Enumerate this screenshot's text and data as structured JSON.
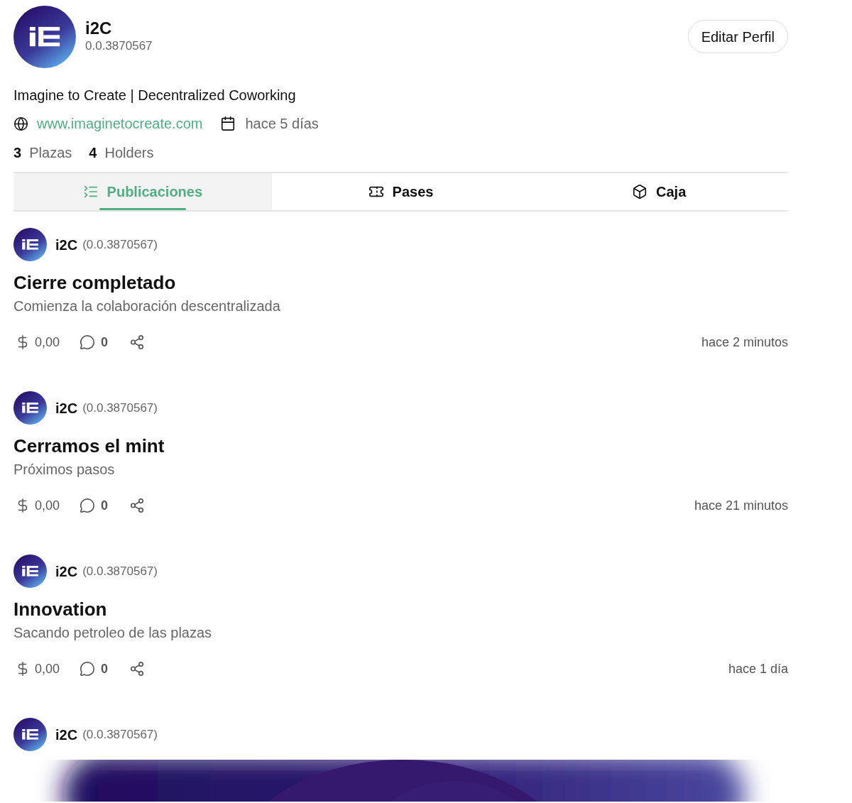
{
  "profile": {
    "name": "i2C",
    "account": "0.0.3870567",
    "edit_button": "Editar Perfil",
    "bio": "Imagine to Create | Decentralized Coworking",
    "website": "www.imaginetocreate.com",
    "joined": "hace 5 días",
    "stats": [
      "**3**  Plazas",
      "**4**  Holders"
    ]
  },
  "tabs": [
    {
      "label": "Publicaciones",
      "selected": true
    },
    {
      "label": "Pases",
      "selected": false
    },
    {
      "label": "Caja",
      "selected": false
    }
  ],
  "posts": [
    {
      "kind": "text",
      "author": "i2C",
      "account": "(0.0.3870567)",
      "title": "Cierre completado",
      "subtitle": "Comienza la colaboración descentralizada",
      "amount": "0,00",
      "comments": "0",
      "time": "hace 2 minutos"
    },
    {
      "kind": "text",
      "author": "i2C",
      "account": "(0.0.3870567)",
      "title": "Cerramos el mint",
      "subtitle": "Próximos pasos",
      "amount": "0,00",
      "comments": "0",
      "time": "hace 21 minutos"
    },
    {
      "kind": "text",
      "author": "i2C",
      "account": "(0.0.3870567)",
      "title": "Innovation",
      "subtitle": "Sacando petroleo de las plazas",
      "amount": "0,00",
      "comments": "0",
      "time": "hace 1 día"
    },
    {
      "kind": "picture",
      "author": "i2C",
      "account": "(0.0.3870567)"
    }
  ]
}
